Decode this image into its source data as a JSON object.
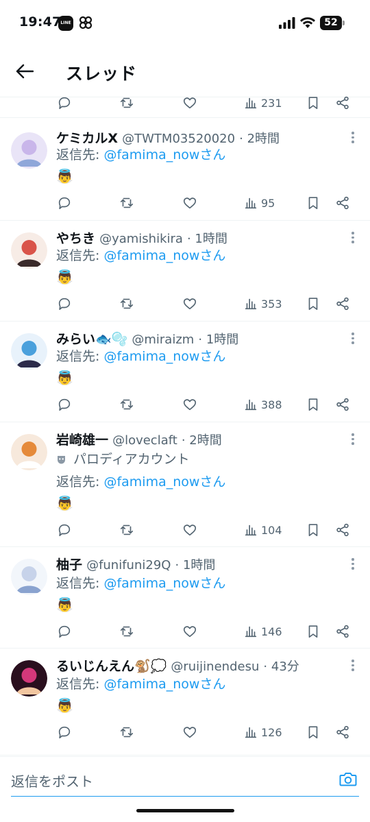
{
  "status_bar": {
    "time": "19:47",
    "line_badge": "LINE",
    "battery": "52"
  },
  "header": {
    "title": "スレッド"
  },
  "partial_row": {
    "views": "231"
  },
  "tweets": [
    {
      "name": "ケミカルX",
      "handle": "@TWTM03520020",
      "time": "· 2時間",
      "reply_prefix": "返信先: ",
      "reply_to": "@famima_nowさん",
      "body": "👼",
      "views": "95"
    },
    {
      "name": "やちき",
      "handle": "@yamishikira",
      "time": "· 1時間",
      "reply_prefix": "返信先: ",
      "reply_to": "@famima_nowさん",
      "body": "👼",
      "views": "353"
    },
    {
      "name": "みらい🐟🫧",
      "handle": "@miraizm",
      "time": "· 1時間",
      "reply_prefix": "返信先: ",
      "reply_to": "@famima_nowさん",
      "body": "👼",
      "views": "388"
    },
    {
      "name": "岩崎雄一",
      "handle": "@loveclaft",
      "time": "· 2時間",
      "badge": "パロディアカウント",
      "reply_prefix": "返信先: ",
      "reply_to": "@famima_nowさん",
      "body": "👼",
      "views": "104"
    },
    {
      "name": "柚子",
      "handle": "@funifuni29Q",
      "time": "· 1時間",
      "reply_prefix": "返信先: ",
      "reply_to": "@famima_nowさん",
      "body": "👼",
      "views": "146"
    },
    {
      "name": "るいじんえん🐒💭",
      "handle": "@ruijinendesu",
      "time": "· 43分",
      "reply_prefix": "返信先: ",
      "reply_to": "@famima_nowさん",
      "body": "👼",
      "views": "126"
    }
  ],
  "composer": {
    "placeholder": "返信をポスト"
  },
  "colors": {
    "accent": "#1d9bf0",
    "text": "#0f1419",
    "muted": "#536471",
    "divider": "#eff3f4"
  }
}
